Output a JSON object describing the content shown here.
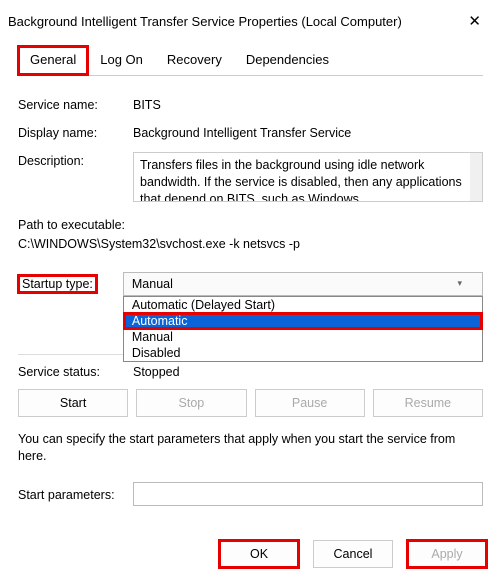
{
  "window": {
    "title": "Background Intelligent Transfer Service Properties (Local Computer)"
  },
  "tabs": {
    "items": [
      {
        "label": "General"
      },
      {
        "label": "Log On"
      },
      {
        "label": "Recovery"
      },
      {
        "label": "Dependencies"
      }
    ]
  },
  "fields": {
    "service_name_label": "Service name:",
    "service_name_value": "BITS",
    "display_name_label": "Display name:",
    "display_name_value": "Background Intelligent Transfer Service",
    "description_label": "Description:",
    "description_value": "Transfers files in the background using idle network bandwidth. If the service is disabled, then any applications that depend on BITS, such as Windows",
    "path_label": "Path to executable:",
    "path_value": "C:\\WINDOWS\\System32\\svchost.exe -k netsvcs -p",
    "startup_label": "Startup type:",
    "startup_value": "Manual",
    "startup_options": [
      "Automatic (Delayed Start)",
      "Automatic",
      "Manual",
      "Disabled"
    ],
    "status_label": "Service status:",
    "status_value": "Stopped",
    "hint": "You can specify the start parameters that apply when you start the service from here.",
    "start_params_label": "Start parameters:",
    "start_params_value": ""
  },
  "buttons": {
    "start": "Start",
    "stop": "Stop",
    "pause": "Pause",
    "resume": "Resume",
    "ok": "OK",
    "cancel": "Cancel",
    "apply": "Apply"
  }
}
